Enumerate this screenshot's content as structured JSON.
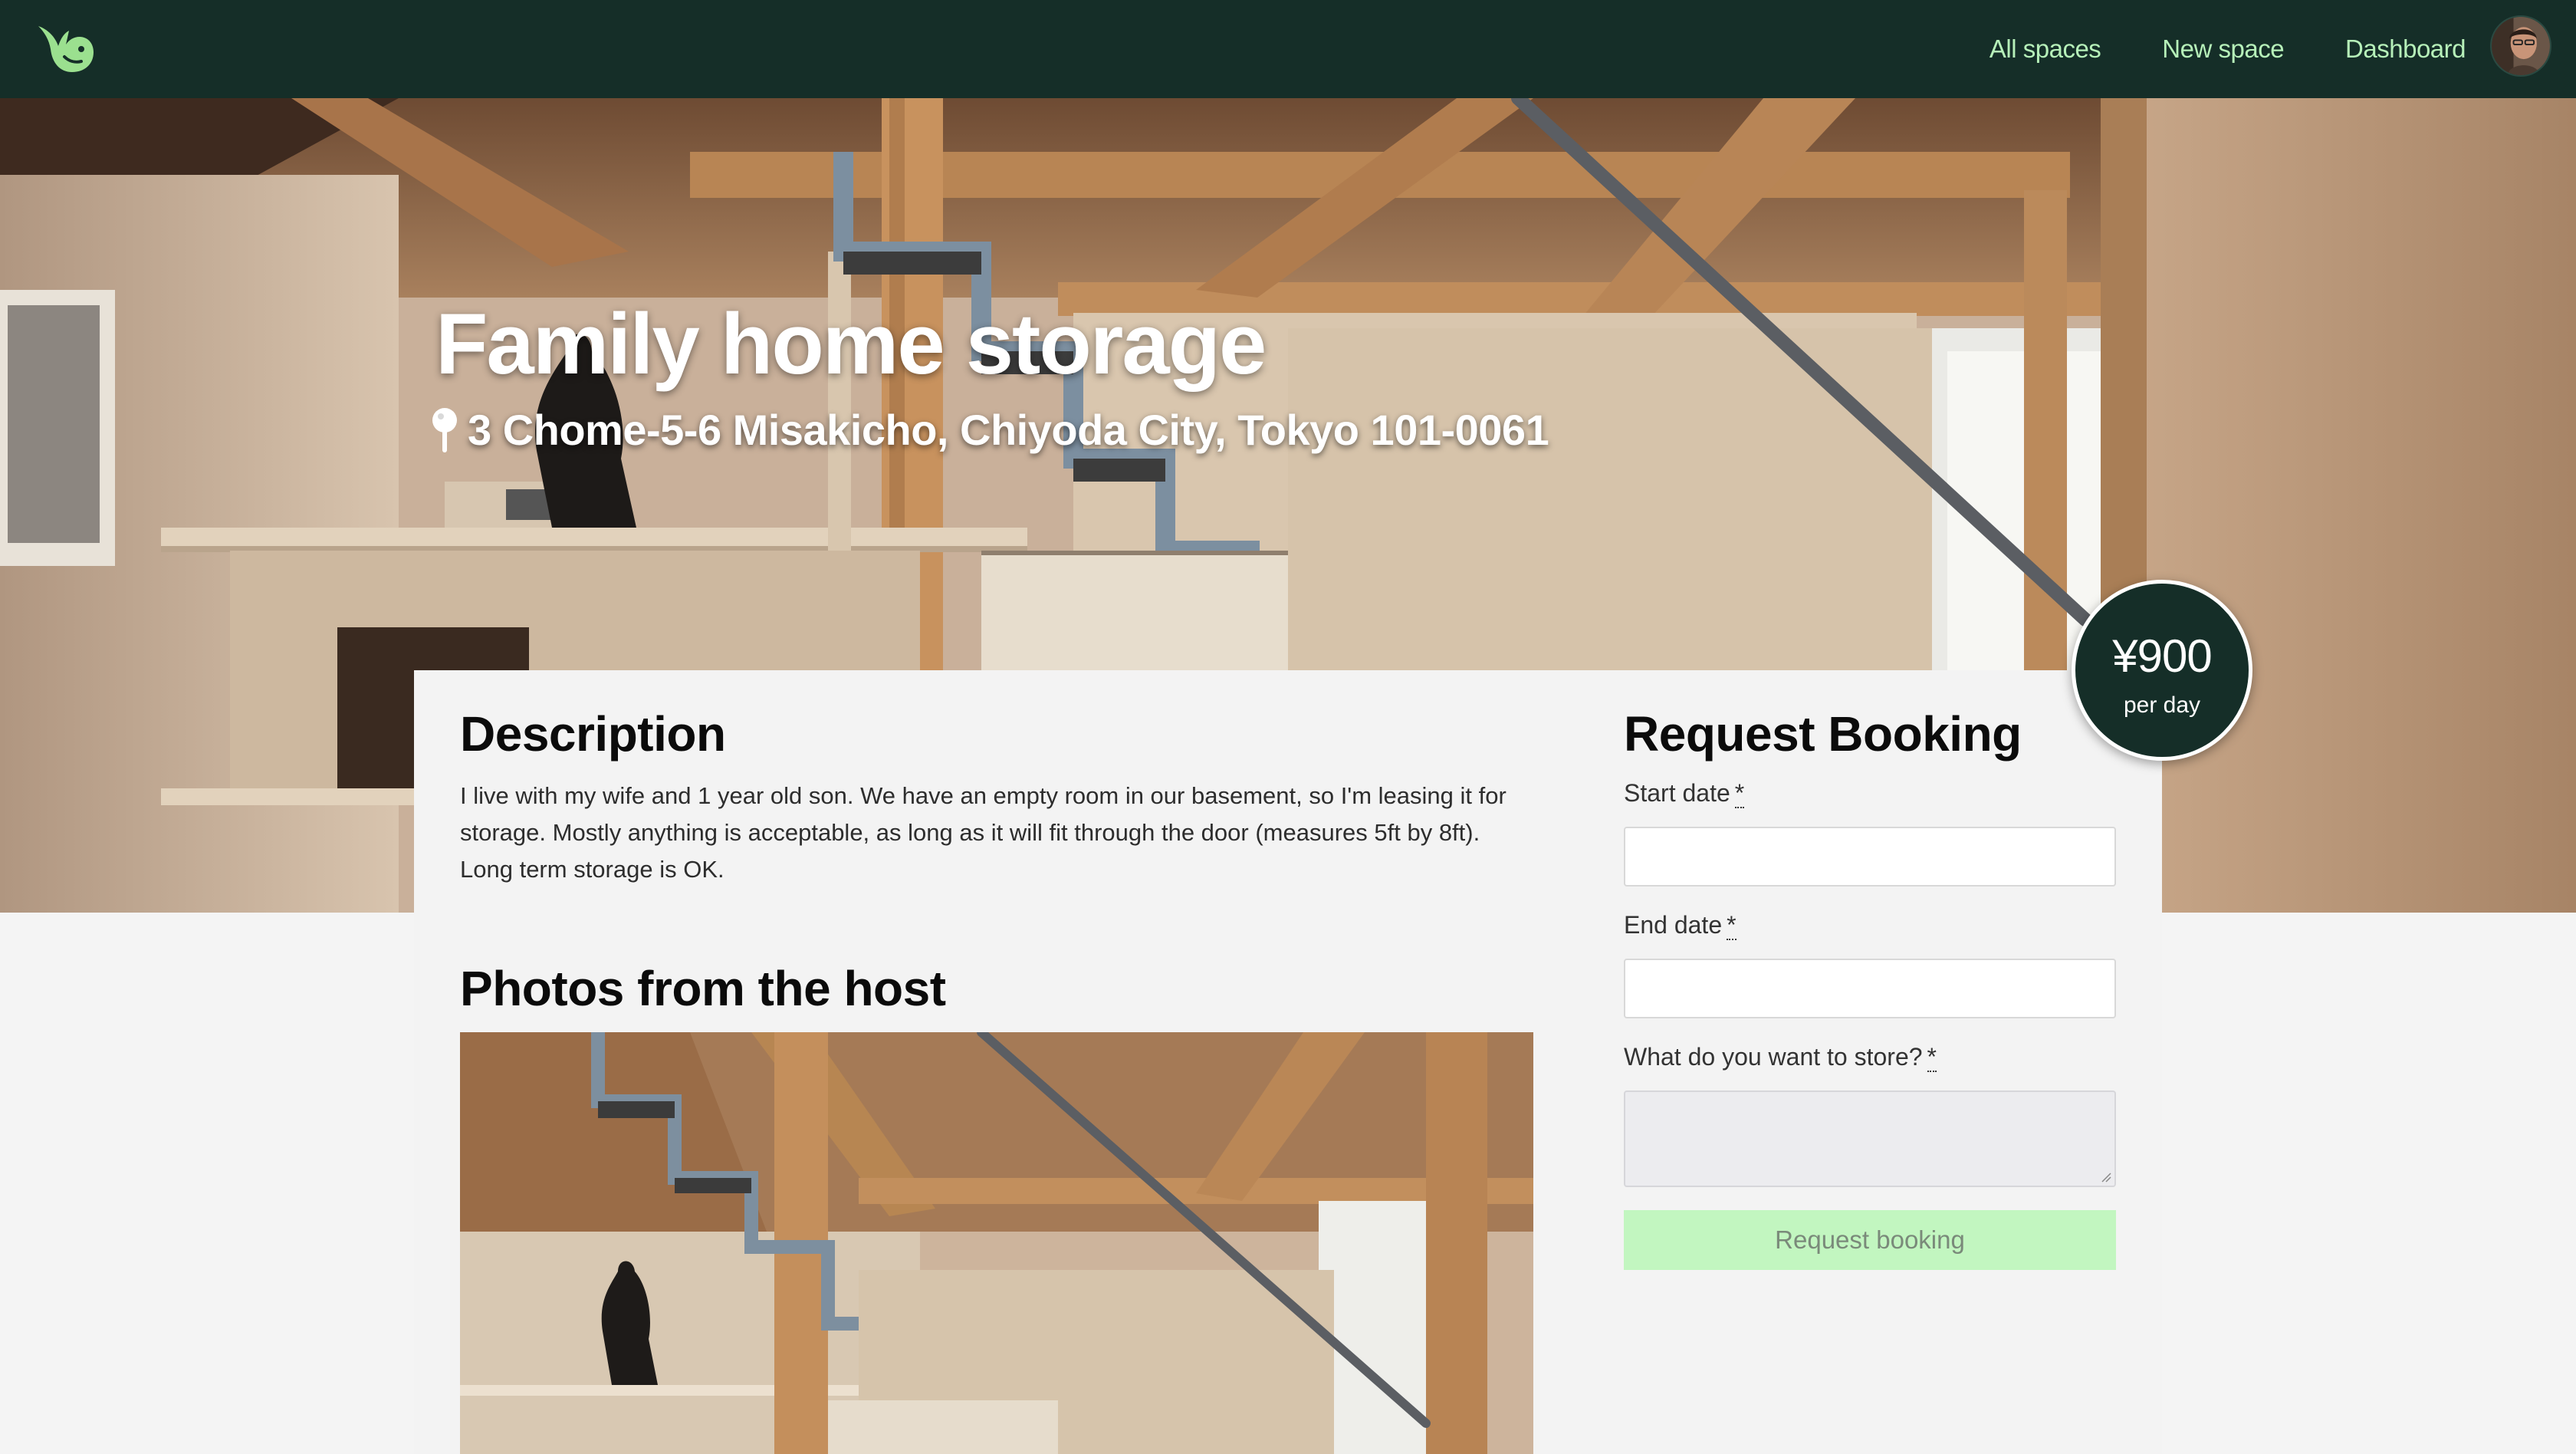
{
  "nav": {
    "links": [
      "All spaces",
      "New space",
      "Dashboard"
    ]
  },
  "listing": {
    "title": "Family home storage",
    "address": "3 Chome-5-6 Misakicho, Chiyoda City, Tokyo 101-0061",
    "price": "¥900",
    "price_unit": "per day"
  },
  "description": {
    "heading": "Description",
    "text": "I live with my wife and 1 year old son. We have an empty room in our basement, so I'm leasing it for storage. Mostly anything is acceptable, as long as it will fit through the door (measures 5ft by 8ft). Long term storage is OK."
  },
  "photos": {
    "heading": "Photos from the host"
  },
  "booking": {
    "heading": "Request Booking",
    "start_label": "Start date",
    "end_label": "End date",
    "store_label": "What do you want to store?",
    "required_marker": "*",
    "submit_label": "Request booking"
  },
  "colors": {
    "nav_bg": "#152e28",
    "nav_link": "#b6f0b9",
    "brand_green": "#9be08f",
    "button_bg": "#c2f6c0",
    "page_bg": "#f4f4f4"
  },
  "icons": [
    "logo-bird-icon",
    "avatar",
    "map-pin-icon",
    "resize-grip-icon"
  ]
}
